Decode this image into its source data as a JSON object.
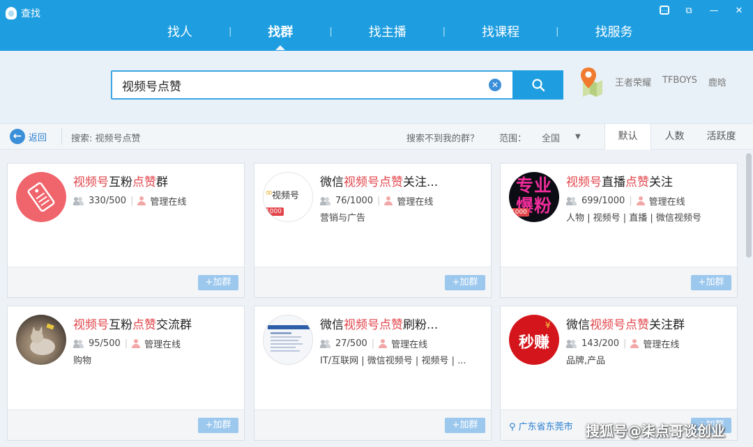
{
  "window": {
    "title": "查找"
  },
  "nav": {
    "tabs": [
      "找人",
      "找群",
      "找主播",
      "找课程",
      "找服务"
    ],
    "active": 1
  },
  "search": {
    "value": "视频号点赞"
  },
  "hot_words": [
    "王者荣耀",
    "TFBOYS",
    "鹿晗"
  ],
  "filter": {
    "back_label": "返回",
    "search_info": "搜索: 视频号点赞",
    "not_found": "搜索不到我的群？",
    "range_label": "范围：",
    "range_value": "全国",
    "sort_tabs": [
      "默认",
      "人数",
      "活跃度"
    ]
  },
  "join_label": "加群",
  "admin_online": "管理在线",
  "cards": [
    {
      "name_parts": [
        {
          "t": "视频号",
          "h": true
        },
        {
          "t": "互粉",
          "h": false
        },
        {
          "t": "点赞",
          "h": true
        },
        {
          "t": "群",
          "h": false
        }
      ],
      "members": "330/500",
      "tags": "",
      "location": "",
      "avatar_text": "",
      "badge": ""
    },
    {
      "name_parts": [
        {
          "t": "微信",
          "h": false
        },
        {
          "t": "视频号点赞",
          "h": true
        },
        {
          "t": "关注...",
          "h": false
        }
      ],
      "members": "76/1000",
      "tags": "营销与广告",
      "location": "",
      "avatar_text": "视频号",
      "badge": "1000"
    },
    {
      "name_parts": [
        {
          "t": "视频号",
          "h": true
        },
        {
          "t": "直播",
          "h": false
        },
        {
          "t": "点赞",
          "h": true
        },
        {
          "t": "关注",
          "h": false
        }
      ],
      "members": "699/1000",
      "tags": "人物 | 视频号 | 直播 | 微信视频号",
      "location": "",
      "avatar_text": "专业爆粉",
      "badge": "1000"
    },
    {
      "name_parts": [
        {
          "t": "视频号",
          "h": true
        },
        {
          "t": "互粉",
          "h": false
        },
        {
          "t": "点赞",
          "h": true
        },
        {
          "t": "交流群",
          "h": false
        }
      ],
      "members": "95/500",
      "tags": "购物",
      "location": "",
      "avatar_text": "",
      "badge": ""
    },
    {
      "name_parts": [
        {
          "t": "微信",
          "h": false
        },
        {
          "t": "视频号点赞",
          "h": true
        },
        {
          "t": "刷粉...",
          "h": false
        }
      ],
      "members": "27/500",
      "tags": "IT/互联网 | 微信视频号 | 视频号 | ...",
      "location": "",
      "avatar_text": "",
      "badge": ""
    },
    {
      "name_parts": [
        {
          "t": "微信",
          "h": false
        },
        {
          "t": "视频号点赞",
          "h": true
        },
        {
          "t": "关注群",
          "h": false
        }
      ],
      "members": "143/200",
      "tags": "品牌,产品",
      "location": "广东省东莞市",
      "avatar_text": "秒赚",
      "badge": ""
    }
  ],
  "watermark": "搜狐号@柒点哥谈创业",
  "colors": {
    "brand": "#1e9ee0",
    "highlight": "#e2454b",
    "join": "#9cc8ee"
  }
}
